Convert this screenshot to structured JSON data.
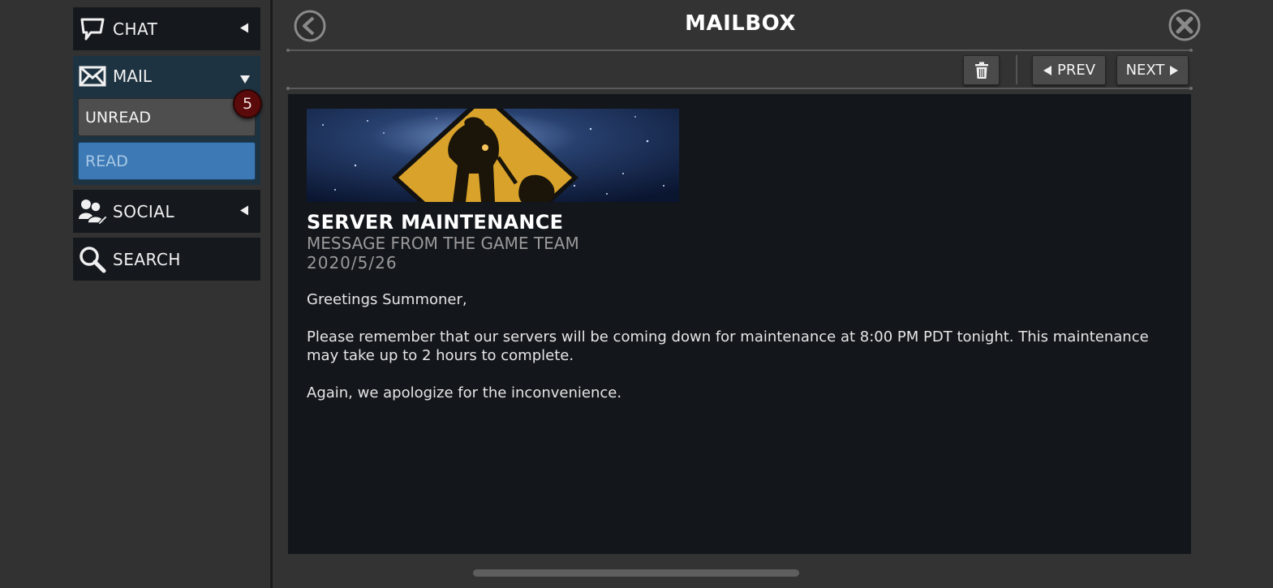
{
  "sidebar": {
    "chat_label": "CHAT",
    "mail_label": "MAIL",
    "unread_label": "UNREAD",
    "unread_count": "5",
    "read_label": "READ",
    "social_label": "SOCIAL",
    "search_label": "SEARCH"
  },
  "header": {
    "title": "MAILBOX"
  },
  "toolbar": {
    "prev_label": "PREV",
    "next_label": "NEXT"
  },
  "message": {
    "title": "SERVER MAINTENANCE",
    "from": "MESSAGE FROM THE GAME TEAM",
    "date": "2020/5/26",
    "greeting": "Greetings Summoner,",
    "body": "Please remember that our servers will be coming down for maintenance at 8:00 PM PDT tonight. This maintenance may take up to 2 hours to complete.",
    "closing": "Again, we apologize for the inconvenience."
  },
  "colors": {
    "selected_tab": "#3d7ab5",
    "mail_group_bg": "#1e3342",
    "badge": "#5a0a0a",
    "panel_bg": "#13161b"
  }
}
